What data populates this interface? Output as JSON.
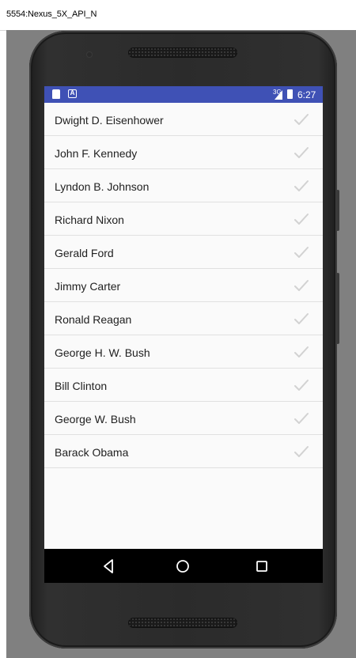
{
  "window": {
    "title": "5554:Nexus_5X_API_N"
  },
  "status_bar": {
    "time": "6:27",
    "network": "3G",
    "color": "#3f51b5"
  },
  "list": {
    "items": [
      "Dwight D. Eisenhower",
      "John F. Kennedy",
      "Lyndon B. Johnson",
      "Richard Nixon",
      "Gerald Ford",
      "Jimmy Carter",
      "Ronald Reagan",
      "George H. W. Bush",
      "Bill Clinton",
      "George W. Bush",
      "Barack Obama"
    ],
    "checked": false,
    "check_icon": "check-icon"
  },
  "nav_bar": {
    "buttons": [
      "back-icon",
      "home-icon",
      "recents-icon"
    ]
  }
}
